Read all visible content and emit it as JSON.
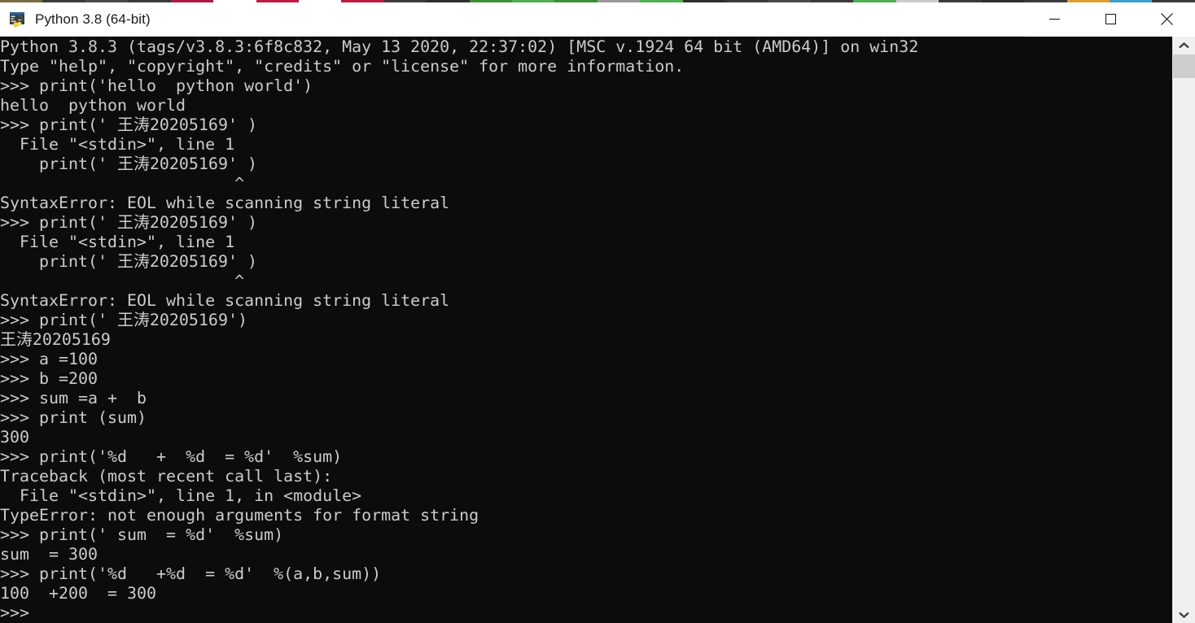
{
  "window": {
    "title": "Python 3.8 (64-bit)",
    "app_icon": "python-console-icon",
    "background_color": "#0c0c0c",
    "titlebar_color": "#ffffff",
    "text_color": "#cccccc"
  },
  "titlebar_buttons": [
    {
      "name": "minimize",
      "glyph": "minimize-icon",
      "label": "Minimize"
    },
    {
      "name": "maximize",
      "glyph": "maximize-icon",
      "label": "Maximize"
    },
    {
      "name": "close",
      "glyph": "close-icon",
      "label": "Close"
    }
  ],
  "scrollbar": {
    "up_arrow": "chevron-up-icon",
    "down_arrow": "chevron-down-icon",
    "thumb_color": "#cdcdcd",
    "track_color": "#f0f0f0",
    "thumb_position_percent": 0
  },
  "console": {
    "prompt": ">>>",
    "lines": [
      "Python 3.8.3 (tags/v3.8.3:6f8c832, May 13 2020, 22:37:02) [MSC v.1924 64 bit (AMD64)] on win32",
      "Type \"help\", \"copyright\", \"credits\" or \"license\" for more information.",
      ">>> print('hello  python world')",
      "hello  python world",
      ">>> print(' 王涛20205169' )",
      "  File \"<stdin>\", line 1",
      "    print(' 王涛20205169' )",
      "                        ^",
      "SyntaxError: EOL while scanning string literal",
      ">>> print(' 王涛20205169' )",
      "  File \"<stdin>\", line 1",
      "    print(' 王涛20205169' )",
      "                        ^",
      "SyntaxError: EOL while scanning string literal",
      ">>> print(' 王涛20205169')",
      "王涛20205169",
      ">>> a =100",
      ">>> b =200",
      ">>> sum =a +  b",
      ">>> print (sum)",
      "300",
      ">>> print('%d   +  %d  = %d'  %sum)",
      "Traceback (most recent call last):",
      "  File \"<stdin>\", line 1, in <module>",
      "TypeError: not enough arguments for format string",
      ">>> print(' sum  = %d'  %sum)",
      "sum  = 300",
      ">>> print('%d   +%d  = %d'  %(a,b,sum))",
      "100  +200  = 300",
      ">>> "
    ],
    "text": "Python 3.8.3 (tags/v3.8.3:6f8c832, May 13 2020, 22:37:02) [MSC v.1924 64 bit (AMD64)] on win32\nType \"help\", \"copyright\", \"credits\" or \"license\" for more information.\n>>> print('hello  python world')\nhello  python world\n>>> print(' 王涛20205169' )\n  File \"<stdin>\", line 1\n    print(' 王涛20205169' )\n                        ^\nSyntaxError: EOL while scanning string literal\n>>> print(' 王涛20205169' )\n  File \"<stdin>\", line 1\n    print(' 王涛20205169' )\n                        ^\nSyntaxError: EOL while scanning string literal\n>>> print(' 王涛20205169')\n王涛20205169\n>>> a =100\n>>> b =200\n>>> sum =a +  b\n>>> print (sum)\n300\n>>> print('%d   +  %d  = %d'  %sum)\nTraceback (most recent call last):\n  File \"<stdin>\", line 1, in <module>\nTypeError: not enough arguments for format string\n>>> print(' sum  = %d'  %sum)\nsum  = 300\n>>> print('%d   +%d  = %d'  %(a,b,sum))\n100  +200  = 300\n>>> "
  },
  "desktop_strip_colors": [
    "#7a6b42",
    "#3a3a3a",
    "#4a4a4a",
    "#3a3a3a",
    "#b01840",
    "#ffffff",
    "#c01840",
    "#ffffff",
    "#c01840",
    "#3a3a3a",
    "#2e2e2e",
    "#3a8f3a",
    "#4fae4f",
    "#3a8f3a",
    "#999999",
    "#4fae4f",
    "#2e2e2e",
    "#3a3a3a",
    "#4a4a4a",
    "#3a3a3a",
    "#4fae4f",
    "#cccccc",
    "#3a3a3a",
    "#2e2e2e",
    "#3a3a3a",
    "#e0a030",
    "#3a9fd0",
    "#3a3a3a"
  ]
}
